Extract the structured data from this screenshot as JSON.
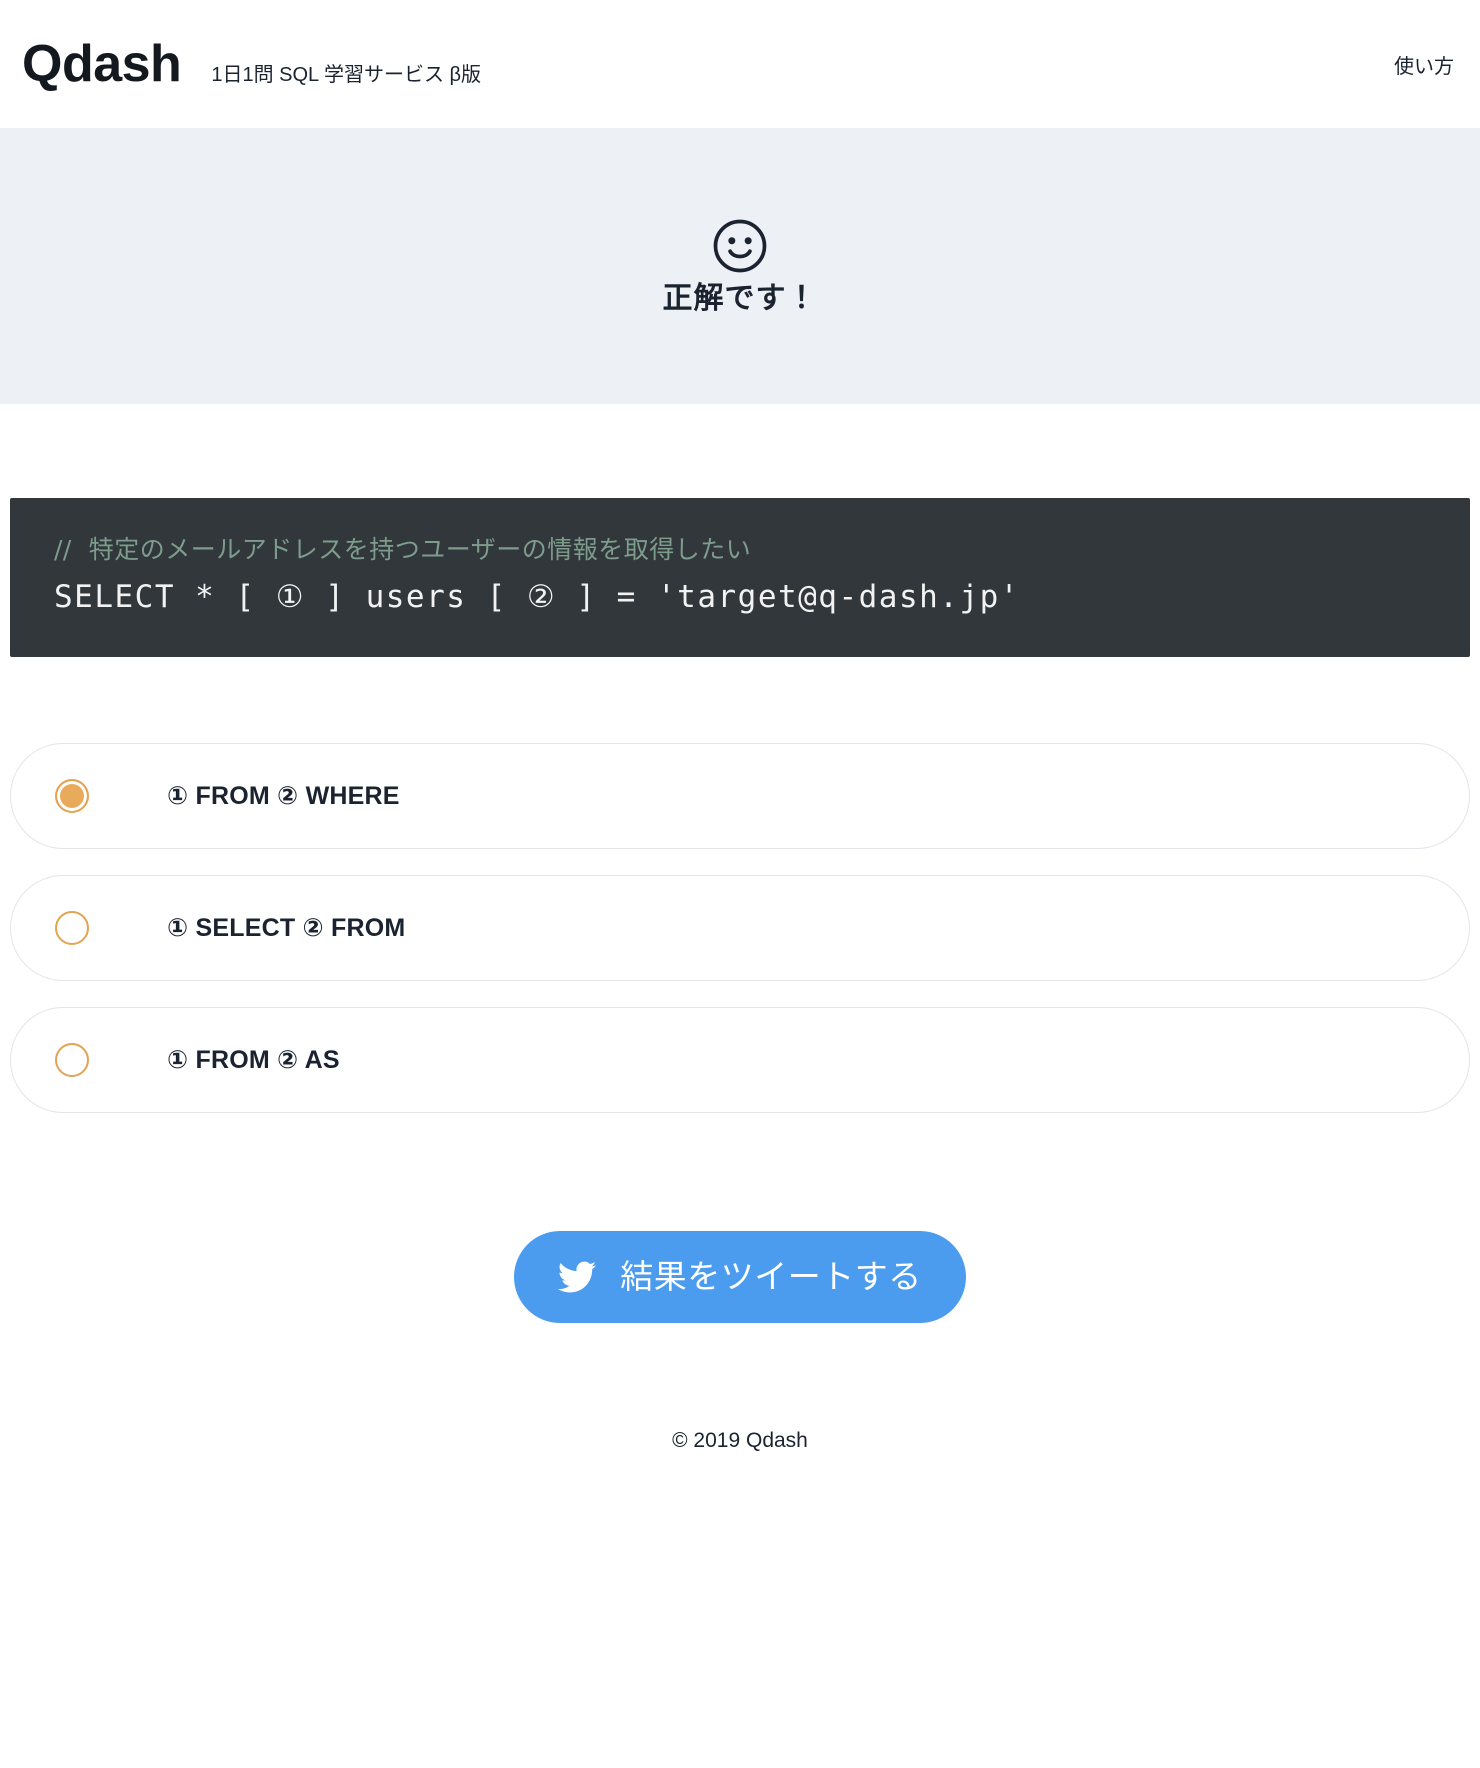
{
  "header": {
    "brand": "Qdash",
    "tagline": "1日1問 SQL 学習サービス β版",
    "nav_link": "使い方"
  },
  "result": {
    "icon": "smiley-face-icon",
    "message": "正解です！",
    "background_color": "#edf0f5"
  },
  "question": {
    "comment": "//  特定のメールアドレスを持つユーザーの情報を取得したい",
    "sql": "SELECT * [ ① ] users [ ② ] = 'target@q-dash.jp'",
    "code_background": "#31373a",
    "comment_color": "#7d9c8c",
    "sql_color": "#f2f2f2"
  },
  "choices": [
    {
      "label": "① FROM ② WHERE",
      "selected": true
    },
    {
      "label": "① SELECT ② FROM",
      "selected": false
    },
    {
      "label": "① FROM ② AS",
      "selected": false
    }
  ],
  "tweet": {
    "icon": "twitter-bird-icon",
    "label": "結果をツイートする",
    "background_color": "#4b9cef"
  },
  "footer": {
    "copyright": "© 2019 Qdash"
  },
  "accent_color": "#e8ab5c"
}
